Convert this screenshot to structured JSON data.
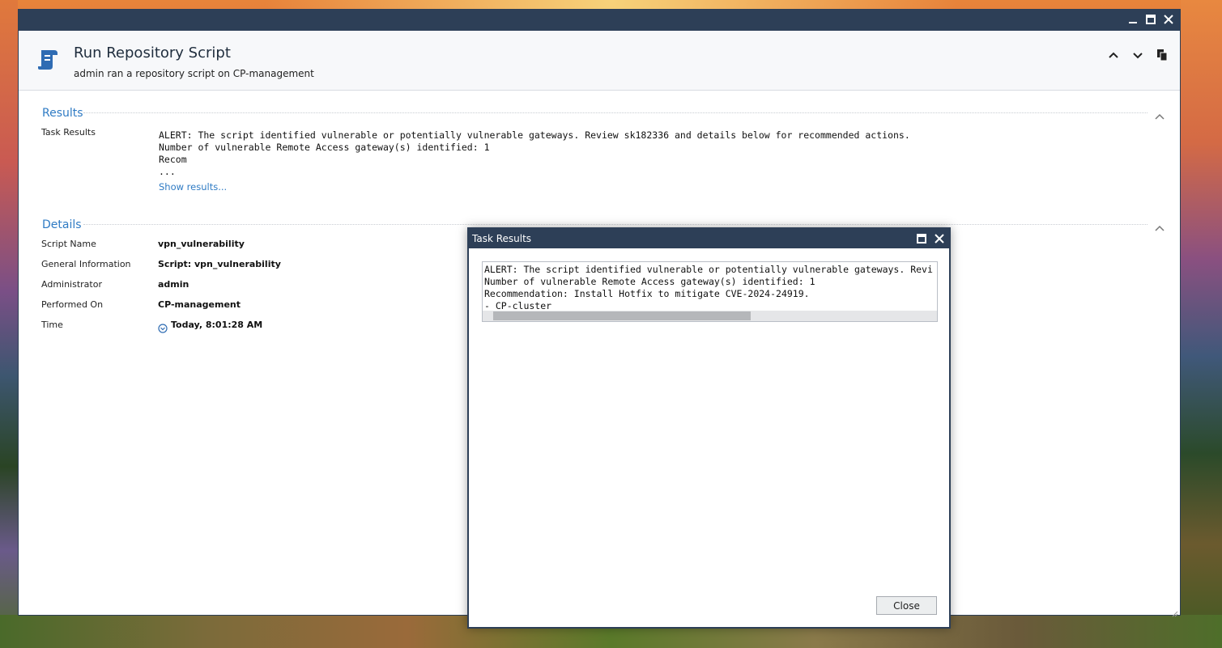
{
  "main_window": {
    "header": {
      "title": "Run Repository Script",
      "subtitle": "admin ran a repository script on CP-management"
    }
  },
  "results_section": {
    "title": "Results",
    "task_results_label": "Task Results",
    "lines": [
      "ALERT: The script identified vulnerable or potentially vulnerable gateways. Review sk182336 and details below for recommended actions.",
      "Number of vulnerable Remote Access gateway(s) identified: 1",
      "Recom",
      "..."
    ],
    "show_results_link": "Show results..."
  },
  "details_section": {
    "title": "Details",
    "rows": [
      {
        "label": "Script Name",
        "value": "vpn_vulnerability"
      },
      {
        "label": "General Information",
        "value": "Script: vpn_vulnerability"
      },
      {
        "label": "Administrator",
        "value": "admin"
      },
      {
        "label": "Performed On",
        "value": "CP-management"
      },
      {
        "label": "Time",
        "value": "Today, 8:01:28 AM"
      }
    ]
  },
  "task_results_dialog": {
    "title": "Task Results",
    "lines": [
      "ALERT: The script identified vulnerable or potentially vulnerable gateways. Revi",
      "Number of vulnerable Remote Access gateway(s) identified: 1",
      "Recommendation: Install Hotfix to mitigate CVE-2024-24919.",
      "- CP-cluster"
    ],
    "scroll_position": 0.0,
    "close_label": "Close"
  },
  "colors": {
    "titlebar": "#2d3f57",
    "accent": "#2f7bc4"
  }
}
